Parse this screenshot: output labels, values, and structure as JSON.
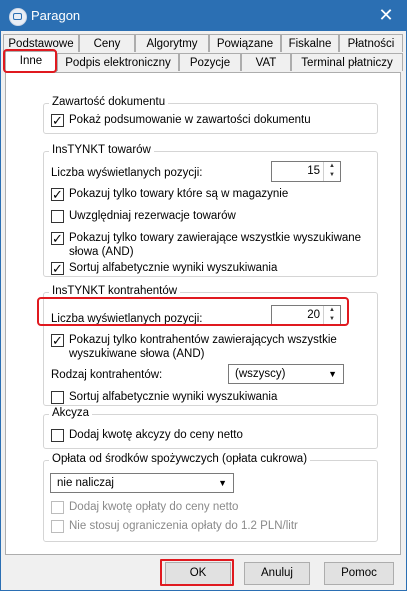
{
  "window": {
    "title": "Paragon",
    "close_glyph": "✕"
  },
  "tabs_row1": [
    "Podstawowe",
    "Ceny",
    "Algorytmy",
    "Powiązane",
    "Fiskalne",
    "Płatności"
  ],
  "tabs_row2": [
    "Inne",
    "Podpis elektroniczny",
    "Pozycje",
    "VAT",
    "Terminal płatniczy"
  ],
  "active_tab": "Inne",
  "groups": {
    "zawartosc": {
      "title": "Zawartość dokumentu",
      "cb1": "Pokaż podsumowanie w zawartości dokumentu",
      "cb1_checked": true
    },
    "towary": {
      "title": "InsTYNKT towarów",
      "count_label": "Liczba wyświetlanych pozycji:",
      "count_value": "15",
      "cb1": "Pokazuj tylko towary które są w magazynie",
      "cb2": "Uwzględniaj rezerwacje towarów",
      "cb3_line1": "Pokazuj tylko towary zawierające wszystkie wyszukiwane",
      "cb3_line2": "słowa (AND)",
      "cb4": "Sortuj alfabetycznie wyniki wyszukiwania"
    },
    "kontrahenci": {
      "title": "InsTYNKT kontrahentów",
      "count_label": "Liczba wyświetlanych pozycji:",
      "count_value": "20",
      "cb1_line1": "Pokazuj tylko kontrahentów zawierających wszystkie",
      "cb1_line2": "wyszukiwane słowa (AND)",
      "rodzaj_label": "Rodzaj kontrahentów:",
      "rodzaj_value": "(wszyscy)",
      "cb2": "Sortuj alfabetycznie wyniki wyszukiwania"
    },
    "akcyza": {
      "title": "Akcyza",
      "cb1": "Dodaj kwotę akcyzy do ceny netto"
    },
    "oplata": {
      "title": "Opłata od środków spożywczych (opłata cukrowa)",
      "select_value": "nie naliczaj",
      "cb1": "Dodaj kwotę opłaty do ceny netto",
      "cb2": "Nie stosuj ograniczenia opłaty do 1.2 PLN/litr"
    }
  },
  "buttons": {
    "ok": "OK",
    "cancel": "Anuluj",
    "help": "Pomoc"
  },
  "colors": {
    "titlebar": "#2b6fb3",
    "highlight": "#e0191f"
  }
}
